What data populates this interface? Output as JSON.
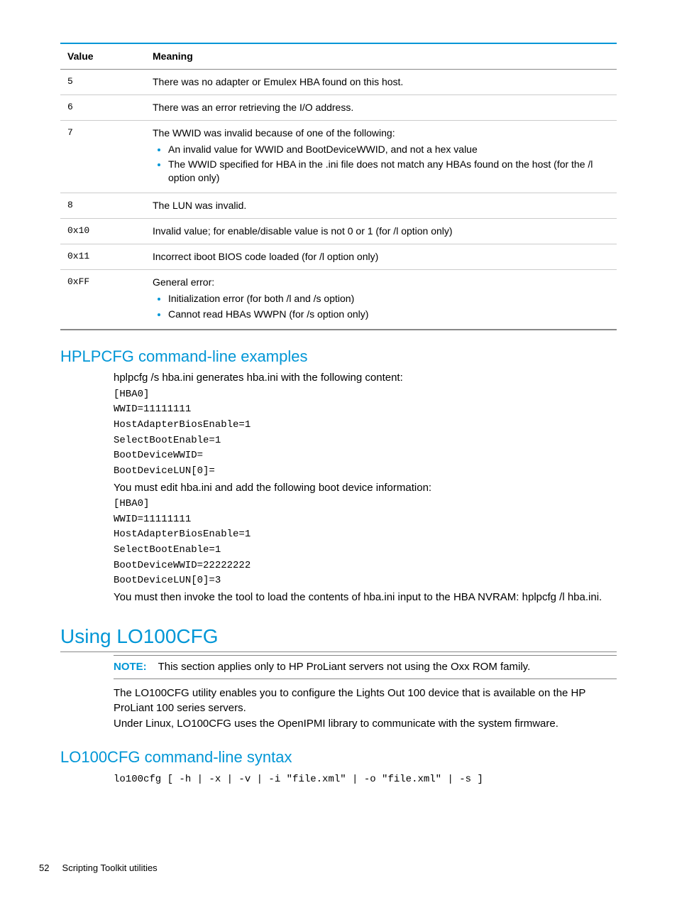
{
  "table": {
    "headers": [
      "Value",
      "Meaning"
    ],
    "rows": [
      {
        "value": "5",
        "meaning": "There was no adapter or Emulex HBA found on this host."
      },
      {
        "value": "6",
        "meaning": "There was an error retrieving the I/O address."
      },
      {
        "value": "7",
        "meaning": "The WWID was invalid because of one of the following:",
        "bullets": [
          "An invalid value for WWID and BootDeviceWWID, and not a hex value",
          "The WWID specified for HBA in the .ini file does not match any HBAs found on the host (for the /l option only)"
        ]
      },
      {
        "value": "8",
        "meaning": "The LUN was invalid."
      },
      {
        "value": "0x10",
        "meaning": "Invalid value; for enable/disable value is not 0 or 1 (for /l option only)"
      },
      {
        "value": "0x11",
        "meaning": "Incorrect iboot BIOS code loaded (for /l option only)"
      },
      {
        "value": "0xFF",
        "meaning": "General error:",
        "bullets": [
          "Initialization error (for both /l and /s option)",
          "Cannot read HBAs WWPN (for /s option only)"
        ]
      }
    ]
  },
  "sec1": {
    "title": "HPLPCFG command-line examples",
    "intro": "hplpcfg /s hba.ini generates hba.ini with the following content:",
    "block1": [
      "[HBA0]",
      "WWID=11111111",
      "HostAdapterBiosEnable=1",
      "SelectBootEnable=1",
      "BootDeviceWWID=",
      "BootDeviceLUN[0]="
    ],
    "mid": "You must edit hba.ini and add the following boot device information:",
    "block2": [
      "[HBA0]",
      "WWID=11111111",
      "HostAdapterBiosEnable=1",
      "SelectBootEnable=1",
      "BootDeviceWWID=22222222",
      "BootDeviceLUN[0]=3"
    ],
    "outro": "You must then invoke the tool to load the contents of hba.ini input to the HBA NVRAM: hplpcfg /l hba.ini."
  },
  "sec2": {
    "title": "Using LO100CFG",
    "note_label": "NOTE:",
    "note_text": "This section applies only to HP ProLiant servers not using the Oxx ROM family.",
    "p1": "The LO100CFG utility enables you to configure the Lights Out 100 device that is available on the HP ProLiant 100 series servers.",
    "p2": "Under Linux, LO100CFG uses the OpenIPMI library to communicate with the system firmware."
  },
  "sec3": {
    "title": "LO100CFG command-line syntax",
    "code": "lo100cfg [ -h | -x | -v | -i \"file.xml\" | -o \"file.xml\" | -s ]"
  },
  "footer": {
    "page": "52",
    "title": "Scripting Toolkit utilities"
  }
}
